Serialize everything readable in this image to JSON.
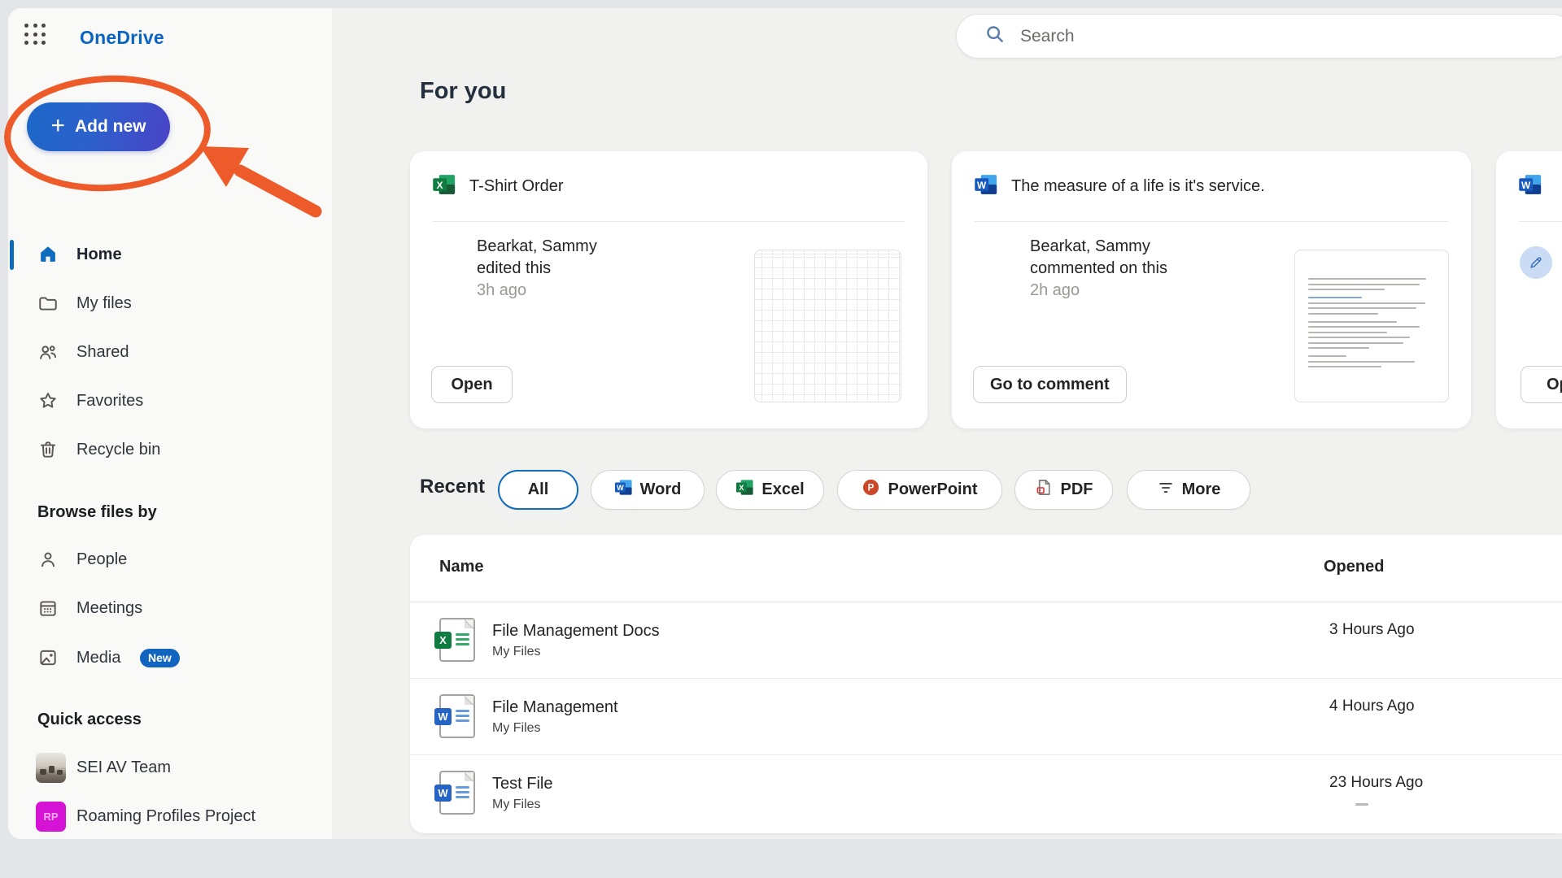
{
  "app": {
    "brand": "OneDrive"
  },
  "topbar": {
    "search_placeholder": "Search"
  },
  "sidebar": {
    "add_new": {
      "label": "Add new"
    },
    "nav": [
      {
        "label": "Home",
        "active": true
      },
      {
        "label": "My files"
      },
      {
        "label": "Shared"
      },
      {
        "label": "Favorites"
      },
      {
        "label": "Recycle bin"
      }
    ],
    "browse_section": {
      "title": "Browse files by",
      "items": [
        {
          "label": "People"
        },
        {
          "label": "Meetings"
        },
        {
          "label": "Media",
          "badge": "New"
        }
      ]
    },
    "quick_access": {
      "title": "Quick access",
      "items": [
        {
          "label": "SEI AV Team"
        },
        {
          "label": "Roaming Profiles Project",
          "initials": "RP"
        }
      ]
    }
  },
  "annotation": {
    "shape": "orange ellipse with arrow",
    "target": "Add new button",
    "color": "#EE5B2A"
  },
  "for_you": {
    "title": "For you",
    "cards": [
      {
        "file_type": "excel",
        "title": "T-Shirt Order",
        "actor": "Bearkat, Sammy",
        "action_text": "edited this",
        "time": "3h ago",
        "button": "Open",
        "thumbnail": "spreadsheet-grid"
      },
      {
        "file_type": "word",
        "title": "The measure of a life is it's service.",
        "actor": "Bearkat, Sammy",
        "action_text": "commented on this",
        "time": "2h ago",
        "button": "Go to comment",
        "thumbnail": "document-text"
      },
      {
        "file_type": "word",
        "button": "Open",
        "badge": "pencil-edited"
      }
    ]
  },
  "recent": {
    "title": "Recent",
    "filters": [
      {
        "label": "All",
        "active": true
      },
      {
        "label": "Word"
      },
      {
        "label": "Excel"
      },
      {
        "label": "PowerPoint"
      },
      {
        "label": "PDF"
      },
      {
        "label": "More"
      }
    ]
  },
  "recent_table": {
    "columns": [
      "Name",
      "Opened"
    ],
    "rows": [
      {
        "name": "File Management Docs",
        "location": "My Files",
        "opened": "3 Hours Ago",
        "file_type": "excel"
      },
      {
        "name": "File Management",
        "location": "My Files",
        "opened": "4 Hours Ago",
        "file_type": "word"
      },
      {
        "name": "Test File",
        "location": "My Files",
        "opened": "23 Hours Ago",
        "file_type": "word"
      }
    ]
  },
  "icon_letters": {
    "word": "W",
    "excel": "X",
    "powerpoint": "P"
  },
  "colors": {
    "brand_blue": "#0f6cbd",
    "add_new_gradient": [
      "#1c67c8",
      "#4a43c6"
    ],
    "annotation_orange": "#EE5B2A",
    "badge_new_blue": "#1065c0",
    "excel_green": "#107c41",
    "word_blue": "#185abd",
    "powerpoint_red": "#cb4928"
  }
}
